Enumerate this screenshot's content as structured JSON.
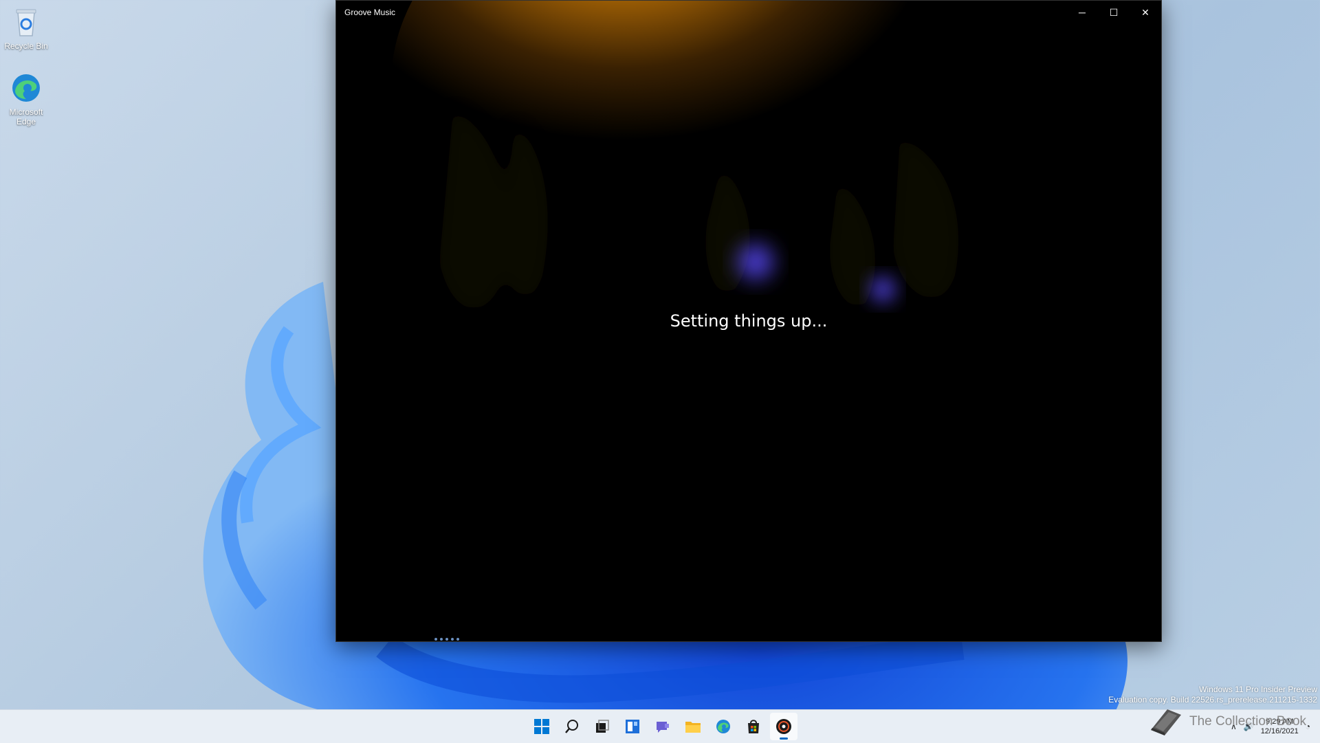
{
  "desktop": {
    "icons": [
      {
        "label": "Recycle Bin"
      },
      {
        "label": "Microsoft Edge"
      }
    ],
    "watermark": {
      "line1": "Windows 11 Pro Insider Preview",
      "line2": "Evaluation copy. Build 22526.rs_prerelease.211215-1332"
    }
  },
  "window": {
    "title": "Groove Music",
    "status_text": "Setting things up...",
    "controls": {
      "minimize": "─",
      "maximize": "☐",
      "close": "✕"
    }
  },
  "taskbar": {
    "apps": [
      "start-icon",
      "search-icon",
      "task-view-icon",
      "widgets-icon",
      "chat-icon",
      "file-explorer-icon",
      "edge-icon",
      "store-icon",
      "groove-music-icon"
    ],
    "active_app": "groove-music-icon",
    "clock": {
      "time": "9:29 AM",
      "date": "12/16/2021"
    },
    "brand_text": "The Collection Book"
  },
  "colors": {
    "accent": "#0067c0",
    "taskbar_bg": "#e8eef5"
  }
}
